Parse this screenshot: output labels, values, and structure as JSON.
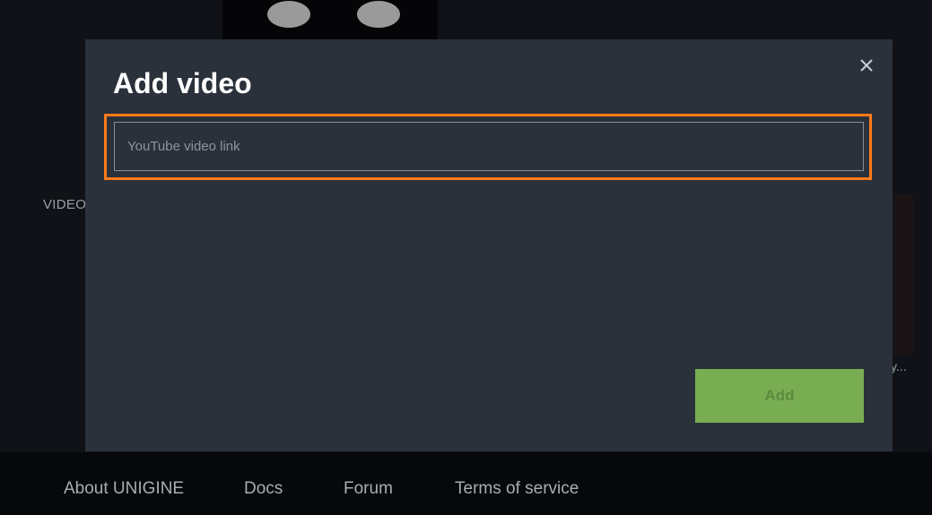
{
  "background": {
    "section_label": "VIDEO",
    "card_title_fragment": "y..."
  },
  "modal": {
    "title": "Add video",
    "close_icon": "close-icon",
    "input": {
      "value": "",
      "placeholder": "YouTube video link"
    },
    "add_label": "Add",
    "highlight_color": "#ff7a1a",
    "add_button_color": "#78ad52"
  },
  "footer": {
    "links": [
      "About UNIGINE",
      "Docs",
      "Forum",
      "Terms of service"
    ]
  }
}
